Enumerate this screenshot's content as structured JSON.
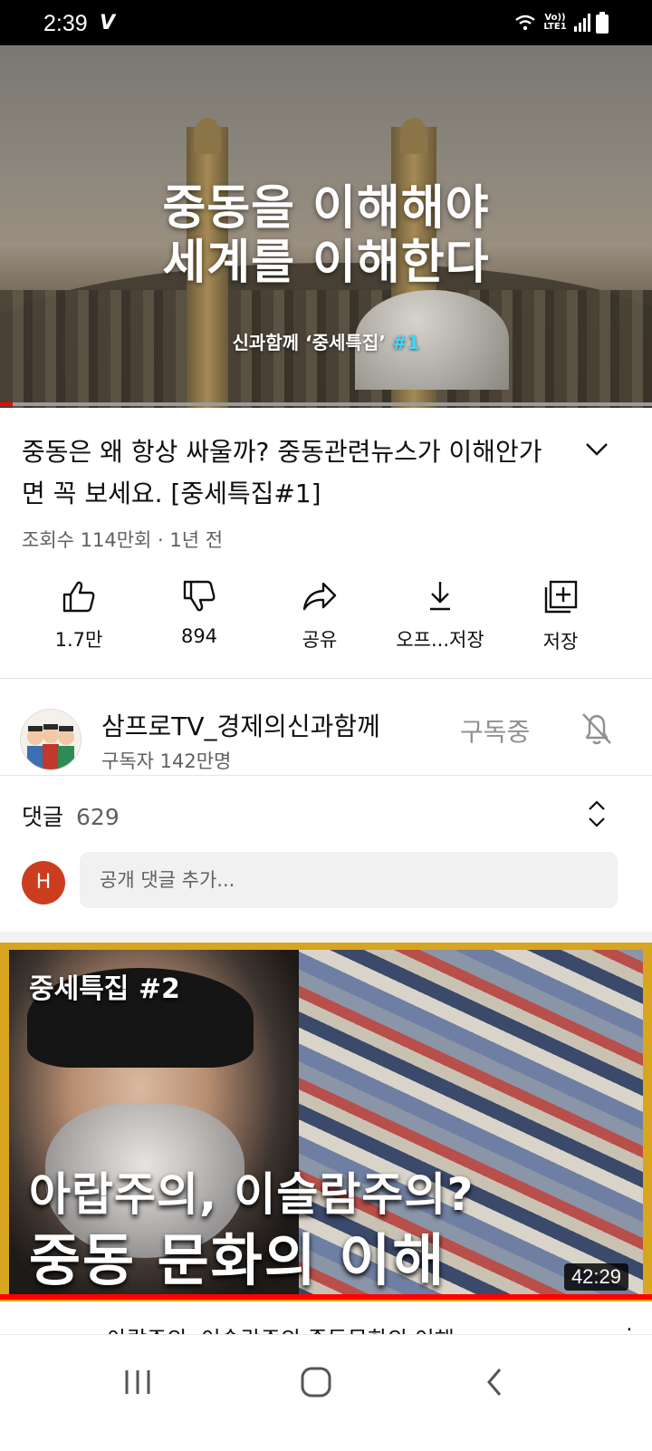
{
  "status_bar": {
    "time": "2:39",
    "carrier_glyph": "V",
    "network": "Vo)) LTE1"
  },
  "player": {
    "title_line1": "중동을 이해해야",
    "title_line2": "세계를 이해한다",
    "subtitle_prefix": "신과함께 ‘중세특집’ ",
    "subtitle_num": "#1",
    "progress_fraction": 0.02
  },
  "video": {
    "title": "중동은 왜 항상 싸울까? 중동관련뉴스가 이해안가면 꼭 보세요. [중세특집#1]",
    "meta": "조회수 114만회 · 1년 전"
  },
  "actions": [
    {
      "label": "1.7만",
      "icon": "thumbs-up-icon"
    },
    {
      "label": "894",
      "icon": "thumbs-down-icon"
    },
    {
      "label": "공유",
      "icon": "share-icon"
    },
    {
      "label": "오프...저장",
      "icon": "download-icon"
    },
    {
      "label": "저장",
      "icon": "add-to-playlist-icon"
    }
  ],
  "channel": {
    "name": "삼프로TV_경제의신과함께",
    "subscribers": "구독자 142만명",
    "subscribe_state": "구독중"
  },
  "comments": {
    "label": "댓글",
    "count": "629",
    "user_initial": "H",
    "placeholder": "공개 댓글 추가..."
  },
  "next_video": {
    "badge": "중세특집 #2",
    "line1": "아랍주의, 이슬람주의?",
    "line2": "중동 문화의 이해",
    "duration": "42:29",
    "title": "아랍주의, 이슬람주의 중동문화의 이해"
  },
  "colors": {
    "accent": "#ff0000",
    "thumb_border": "#d8a521",
    "comment_avatar": "#cc3c1f",
    "subtitle_num": "#3fd8ff"
  }
}
